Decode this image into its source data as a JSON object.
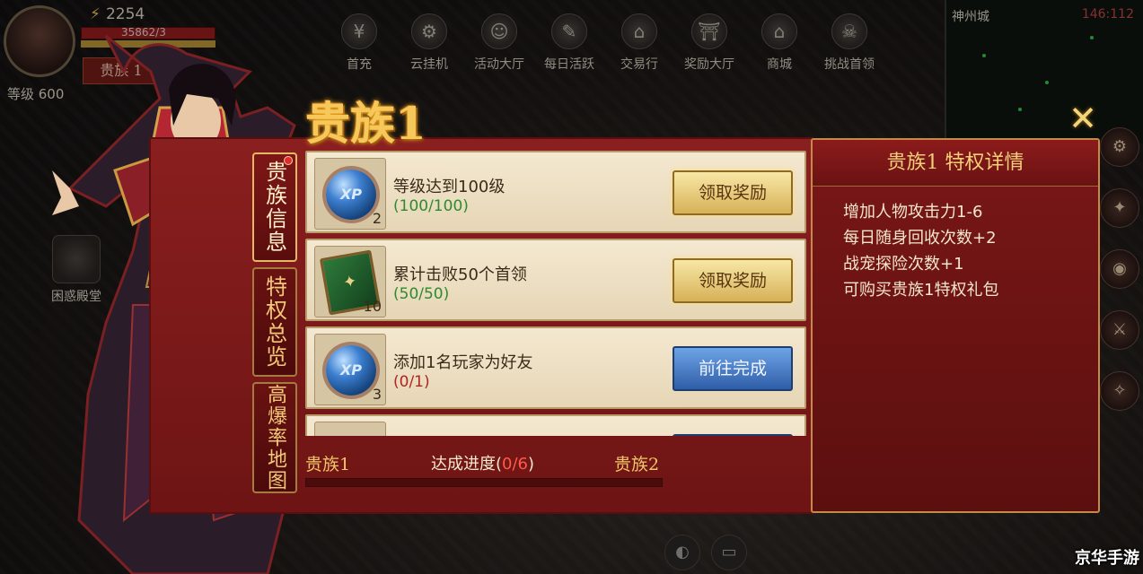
{
  "hud": {
    "power": "2254",
    "hp_text": "35862/3",
    "rank_chip": "贵族 1",
    "level": "等级 600",
    "menu": [
      {
        "label": "首充"
      },
      {
        "label": "云挂机"
      },
      {
        "label": "活动大厅"
      },
      {
        "label": "每日活跃"
      },
      {
        "label": "交易行"
      },
      {
        "label": "奖励大厅"
      },
      {
        "label": "商城"
      },
      {
        "label": "挑战首领"
      }
    ],
    "minimap": {
      "title": "神州城",
      "coords": "146:112"
    },
    "left_icons": [
      {
        "label": "困惑殿堂"
      }
    ],
    "watermark": "京华手游"
  },
  "panel": {
    "title": "贵族1",
    "tabs": [
      {
        "label": "贵族信息",
        "active": true
      },
      {
        "label": "特权总览",
        "active": false
      },
      {
        "label": "高爆率地图",
        "active": false
      }
    ],
    "tasks": [
      {
        "icon": "xp-orb-icon",
        "count": "2",
        "title": "等级达到100级",
        "progress": "(100/100)",
        "done": true,
        "button": "领取奖励"
      },
      {
        "icon": "green-book-icon",
        "count": "10",
        "title": "累计击败50个首领",
        "progress": "(50/50)",
        "done": true,
        "button": "领取奖励"
      },
      {
        "icon": "xp-orb-icon",
        "count": "3",
        "title": "添加1名玩家为好友",
        "progress": "(0/1)",
        "done": false,
        "button": "前往完成"
      }
    ],
    "bottom": {
      "from": "贵族1",
      "to": "贵族2",
      "label_prefix": "达成进度(",
      "label_num": "0/6",
      "label_suffix": ")",
      "progress": 0
    }
  },
  "detail": {
    "header": "贵族1 特权详情",
    "items": [
      "增加人物攻击力1-6",
      "每日随身回收次数+2",
      "战宠探险次数+1",
      "可购买贵族1特权礼包"
    ]
  },
  "colors": {
    "panel_red": "#7a1717",
    "gold_text": "#f4cf7a",
    "done_green": "#2f8a2f",
    "undone_red": "#b02424",
    "btn_gold": "#d6b157",
    "btn_blue": "#2f5ea8"
  }
}
